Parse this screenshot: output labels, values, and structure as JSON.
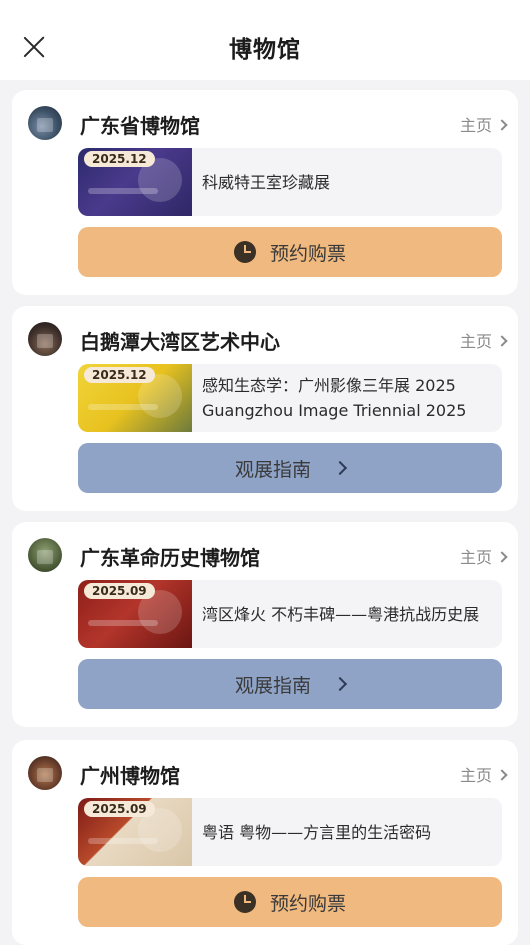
{
  "header": {
    "title": "博物馆",
    "close_icon": "close-icon"
  },
  "museums": [
    {
      "name": "广东省博物馆",
      "home_label": "主页",
      "exhibit": {
        "date": "2025.12",
        "title": "科威特王室珍藏展"
      },
      "action": {
        "type": "ticket",
        "label": "预约购票",
        "icon": "clock-icon"
      }
    },
    {
      "name": "白鹅潭大湾区艺术中心",
      "home_label": "主页",
      "exhibit": {
        "date": "2025.12",
        "title": "感知生态学：广州影像三年展 2025 Guangzhou Image Triennial 2025"
      },
      "action": {
        "type": "guide",
        "label": "观展指南",
        "icon": "chevron-right-icon"
      }
    },
    {
      "name": "广东革命历史博物馆",
      "home_label": "主页",
      "exhibit": {
        "date": "2025.09",
        "title": "湾区烽火 不朽丰碑——粤港抗战历史展"
      },
      "action": {
        "type": "guide",
        "label": "观展指南",
        "icon": "chevron-right-icon"
      }
    },
    {
      "name": "广州博物馆",
      "home_label": "主页",
      "exhibit": {
        "date": "2025.09",
        "title": "粤语 粤物——方言里的生活密码"
      },
      "action": {
        "type": "ticket",
        "label": "预约购票",
        "icon": "clock-icon"
      }
    }
  ],
  "colors": {
    "ticket_button": "#f0b97f",
    "guide_button": "#8fa3c7",
    "background": "#f3f3f6"
  }
}
